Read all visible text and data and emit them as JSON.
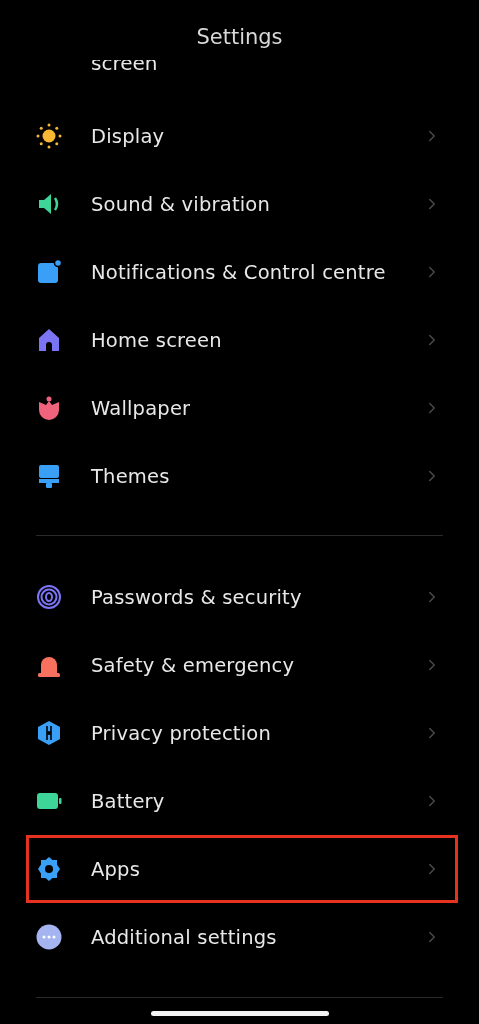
{
  "header": {
    "title": "Settings"
  },
  "partial_item": {
    "label": "screen"
  },
  "sections": [
    {
      "items": [
        {
          "label": "Display",
          "highlighted": false
        },
        {
          "label": "Sound & vibration",
          "highlighted": false
        },
        {
          "label": "Notifications & Control centre",
          "highlighted": false
        },
        {
          "label": "Home screen",
          "highlighted": false
        },
        {
          "label": "Wallpaper",
          "highlighted": false
        },
        {
          "label": "Themes",
          "highlighted": false
        }
      ]
    },
    {
      "items": [
        {
          "label": "Passwords & security",
          "highlighted": false
        },
        {
          "label": "Safety & emergency",
          "highlighted": false
        },
        {
          "label": "Privacy protection",
          "highlighted": false
        },
        {
          "label": "Battery",
          "highlighted": false
        },
        {
          "label": "Apps",
          "highlighted": true
        },
        {
          "label": "Additional settings",
          "highlighted": false
        }
      ]
    }
  ]
}
